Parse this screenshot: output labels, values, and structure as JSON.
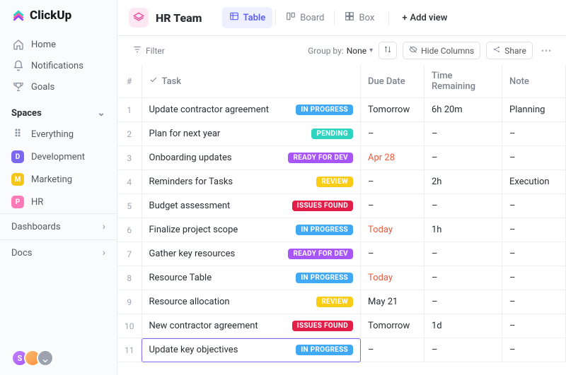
{
  "brand": "ClickUp",
  "sidebar": {
    "nav": [
      {
        "label": "Home",
        "icon": "home"
      },
      {
        "label": "Notifications",
        "icon": "bell"
      },
      {
        "label": "Goals",
        "icon": "trophy"
      }
    ],
    "spaces_header": "Spaces",
    "everything_label": "Everything",
    "spaces": [
      {
        "label": "Development",
        "initial": "D",
        "color": "#7b68ee"
      },
      {
        "label": "Marketing",
        "initial": "M",
        "color": "#f5c518"
      },
      {
        "label": "HR",
        "initial": "P",
        "color": "#ff7ab6"
      }
    ],
    "rows": [
      {
        "label": "Dashboards"
      },
      {
        "label": "Docs"
      }
    ]
  },
  "header": {
    "title": "HR Team",
    "views": [
      {
        "label": "Table",
        "icon": "table",
        "active": true
      },
      {
        "label": "Board",
        "icon": "board",
        "active": false
      },
      {
        "label": "Box",
        "icon": "box",
        "active": false
      }
    ],
    "add_view_label": "Add view"
  },
  "toolbar": {
    "filter_label": "Filter",
    "group_by_label": "Group by:",
    "group_by_value": "None",
    "hide_columns_label": "Hide Columns",
    "share_label": "Share"
  },
  "columns": {
    "num": "#",
    "task": "Task",
    "due": "Due Date",
    "time": "Time Remaining",
    "note": "Note"
  },
  "status_colors": {
    "IN PROGRESS": "#3fa9f5",
    "PENDING": "#2dd4bf",
    "READY FOR DEV": "#a855f7",
    "REVIEW": "#facc15",
    "ISSUES FOUND": "#e11d48"
  },
  "rows": [
    {
      "n": 1,
      "task": "Update contractor agreement",
      "status": "IN PROGRESS",
      "due": "Tomorrow",
      "due_warn": false,
      "time": "6h 20m",
      "note": "Planning"
    },
    {
      "n": 2,
      "task": "Plan for next year",
      "status": "PENDING",
      "due": "–",
      "time": "–",
      "note": "–"
    },
    {
      "n": 3,
      "task": "Onboarding updates",
      "status": "READY FOR DEV",
      "due": "Apr 28",
      "due_warn": true,
      "time": "–",
      "note": "–"
    },
    {
      "n": 4,
      "task": "Reminders for Tasks",
      "status": "REVIEW",
      "due": "–",
      "time": "2h",
      "note": "Execution"
    },
    {
      "n": 5,
      "task": "Budget assessment",
      "status": "ISSUES FOUND",
      "due": "–",
      "time": "–",
      "note": "–"
    },
    {
      "n": 6,
      "task": "Finalize project scope",
      "status": "IN PROGRESS",
      "due": "Today",
      "due_warn": true,
      "time": "1h",
      "note": "–"
    },
    {
      "n": 7,
      "task": "Gather key resources",
      "status": "READY FOR DEV",
      "due": "–",
      "time": "–",
      "note": "–"
    },
    {
      "n": 8,
      "task": "Resource Table",
      "status": "IN PROGRESS",
      "due": "Today",
      "due_warn": true,
      "time": "–",
      "note": "–"
    },
    {
      "n": 9,
      "task": "Resource allocation",
      "status": "REVIEW",
      "due": "May 21",
      "time": "–",
      "note": "–"
    },
    {
      "n": 10,
      "task": "New contractor agreement",
      "status": "ISSUES FOUND",
      "due": "Tomorrow",
      "time": "1d",
      "note": "–"
    },
    {
      "n": 11,
      "task": "Update key objectives",
      "status": "IN PROGRESS",
      "due": "–",
      "time": "–",
      "note": "–",
      "editing": true
    }
  ]
}
